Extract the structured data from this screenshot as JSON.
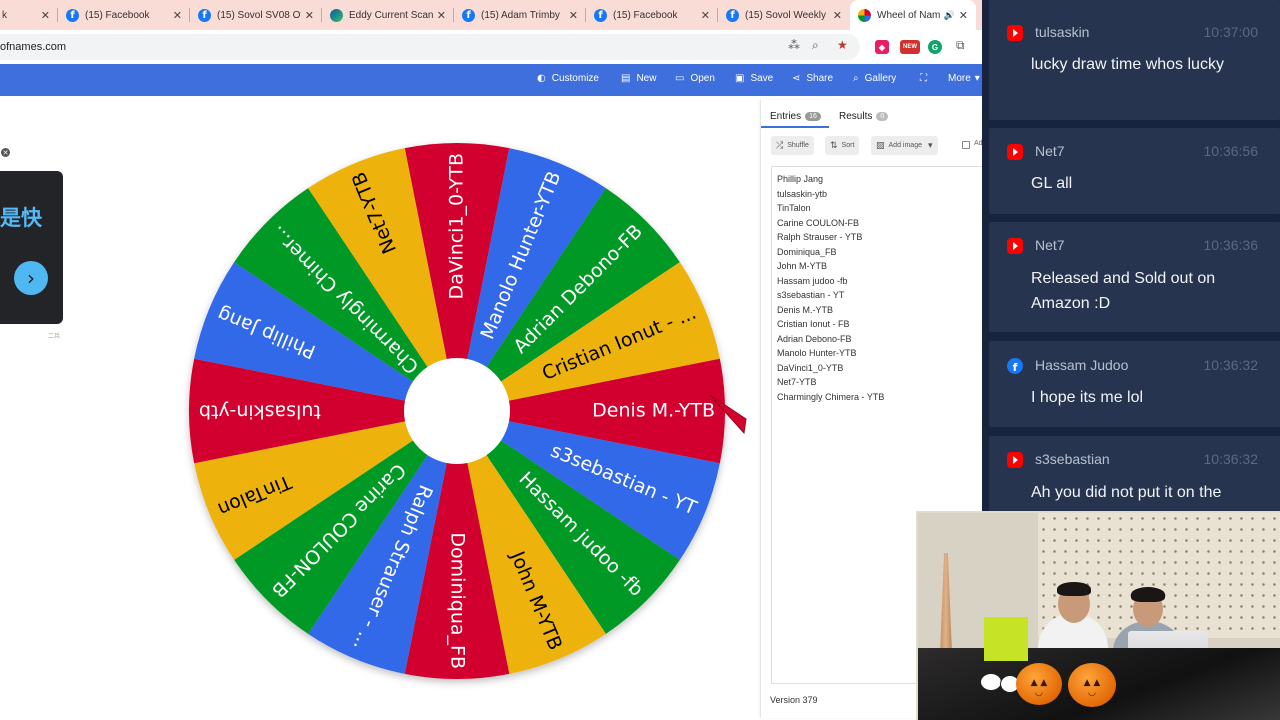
{
  "browser": {
    "tabs": [
      {
        "title": "k",
        "favicon": "none"
      },
      {
        "title": "(15) Facebook",
        "favicon": "facebook-icon"
      },
      {
        "title": "(15) Sovol SV08 Of",
        "favicon": "facebook-icon"
      },
      {
        "title": "Eddy Current Scan",
        "favicon": "edge-icon"
      },
      {
        "title": "(15) Adam Trimby",
        "favicon": "facebook-icon"
      },
      {
        "title": "(15) Facebook",
        "favicon": "facebook-icon"
      },
      {
        "title": "(15) Sovol Weekly",
        "favicon": "facebook-icon"
      },
      {
        "title": "Wheel of Nam",
        "favicon": "wheel-icon",
        "active": true
      }
    ],
    "url": "ofnames.com",
    "ext_new_label": "NEW"
  },
  "toolbar": {
    "customize": "Customize",
    "new": "New",
    "open": "Open",
    "save": "Save",
    "share": "Share",
    "gallery": "Gallery",
    "more": "More"
  },
  "promo": {
    "text": "是快",
    "footer": "二兵"
  },
  "wheel": {
    "colors": [
      "#d2042d",
      "#3369e8",
      "#009925",
      "#eeb211"
    ],
    "segments": [
      "DaVinci1_0-YTB",
      "Manolo Hunter-YTB",
      "Adrian Debono-FB",
      "Cristian Ionut - ...",
      "Denis M.-YTB",
      "s3sebastian - YT",
      "Hassam judoo -fb",
      "John M-YTB",
      "Dominiqua_FB",
      "Ralph Strauser - ...",
      "Carine COULON-FB",
      "TinTalon",
      "tulsaskin-ytb",
      "Phillip Jang",
      "Charmingly Chimer...",
      "Net7-YTB"
    ]
  },
  "panel": {
    "entries_tab": "Entries",
    "entries_count": "16",
    "results_tab": "Results",
    "results_count": "0",
    "shuffle": "Shuffle",
    "sort": "Sort",
    "add_image": "Add image",
    "advanced": "Adva",
    "entries": [
      "Phillip Jang",
      "tulsaskin-ytb",
      "TinTalon",
      "Carine COULON-FB",
      "Ralph Strauser - YTB",
      "Dominiqua_FB",
      "John M-YTB",
      "Hassam judoo -fb",
      "s3sebastian - YT",
      "Denis M.-YTB",
      "Cristian Ionut - FB",
      "Adrian Debono-FB",
      "Manolo Hunter-YTB",
      "DaVinci1_0-YTB",
      "Net7-YTB",
      "Charmingly Chimera - YTB"
    ],
    "version": "Version 379"
  },
  "chat": {
    "messages": [
      {
        "platform": "youtube",
        "user": "tulsaskin",
        "time": "10:37:00",
        "text": "lucky draw time whos lucky"
      },
      {
        "platform": "youtube",
        "user": "Net7",
        "time": "10:36:56",
        "text": "GL all"
      },
      {
        "platform": "youtube",
        "user": "Net7",
        "time": "10:36:36",
        "text": "Released and Sold out on Amazon :D"
      },
      {
        "platform": "facebook",
        "user": "Hassam Judoo",
        "time": "10:36:32",
        "text": "I hope its me lol"
      },
      {
        "platform": "youtube",
        "user": "s3sebastian",
        "time": "10:36:32",
        "text": "Ah you did not put it on the"
      }
    ]
  }
}
